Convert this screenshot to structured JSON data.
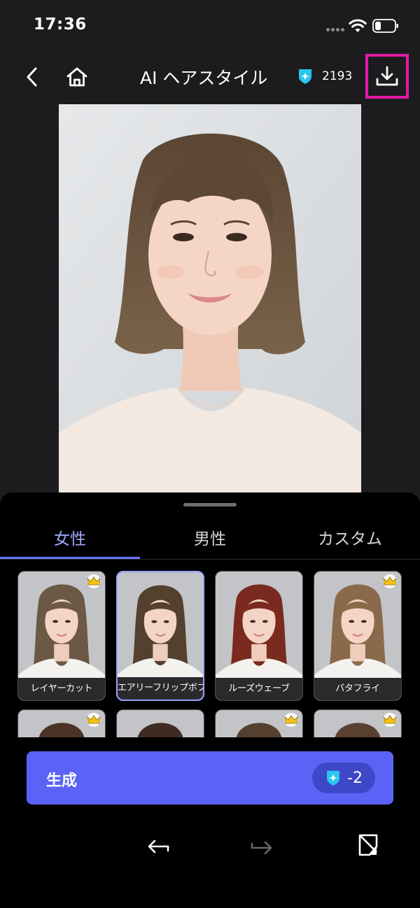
{
  "status_bar": {
    "time": "17:36",
    "icons": [
      "signal-dots-icon",
      "wifi-icon",
      "battery-icon"
    ]
  },
  "header": {
    "back_icon": "chevron-left-icon",
    "home_icon": "home-icon",
    "title": "AI ヘアスタイル",
    "credit_icon": "gem-shield-icon",
    "credits": "2193",
    "download_icon": "download-icon",
    "highlight_color": "#e21aa6"
  },
  "photo": {
    "subject": "portrait-photo"
  },
  "tabs": [
    {
      "label": "女性",
      "active": true
    },
    {
      "label": "男性",
      "active": false
    },
    {
      "label": "カスタム",
      "active": false
    }
  ],
  "styles": [
    {
      "label": "レイヤーカット",
      "premium": true,
      "selected": false,
      "hair_color": "#6b5845"
    },
    {
      "label": "エアリーフリップボブ",
      "premium": false,
      "selected": true,
      "hair_color": "#54402f"
    },
    {
      "label": "ルーズウェーブ",
      "premium": false,
      "selected": false,
      "hair_color": "#7a2a1e"
    },
    {
      "label": "バタフライ",
      "premium": true,
      "selected": false,
      "hair_color": "#8a6a4a"
    },
    {
      "label": "",
      "premium": true,
      "selected": false,
      "hair_color": "#4b3328"
    },
    {
      "label": "",
      "premium": false,
      "selected": false,
      "hair_color": "#3e2c22"
    },
    {
      "label": "",
      "premium": true,
      "selected": false,
      "hair_color": "#55402f"
    },
    {
      "label": "",
      "premium": true,
      "selected": false,
      "hair_color": "#5a4030"
    }
  ],
  "generate": {
    "label": "生成",
    "cost_icon": "gem-shield-icon",
    "cost": "-2",
    "color": "#5a63f6"
  },
  "tools": {
    "undo_icon": "undo-arrow-icon",
    "redo_icon": "redo-arrow-icon",
    "compare_icon": "compare-icon"
  },
  "colors": {
    "accent": "#9ea7ff",
    "background": "#1c1c1f",
    "sheet": "#000000",
    "crown": "#f5c21a"
  }
}
